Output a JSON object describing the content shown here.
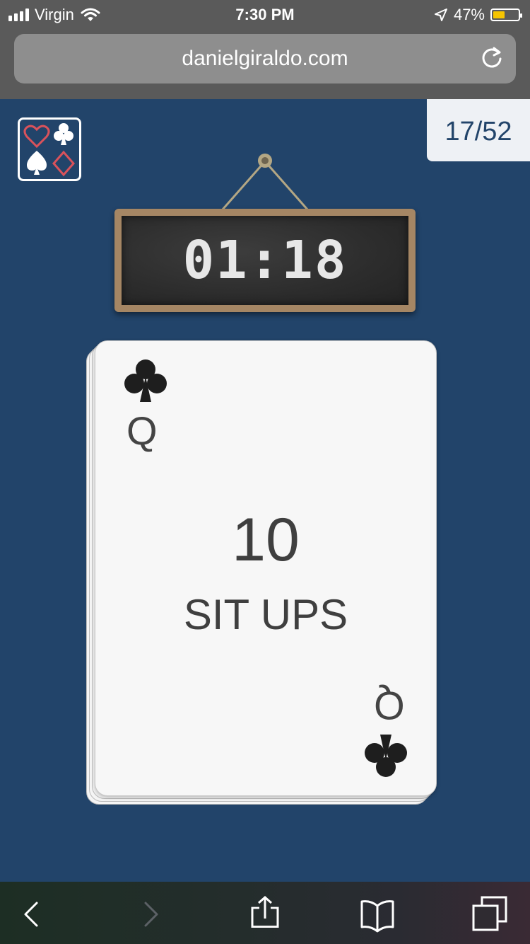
{
  "status_bar": {
    "carrier": "Virgin",
    "time": "7:30 PM",
    "battery_percent": "47%",
    "battery_level": 0.47
  },
  "browser": {
    "url": "danielgiraldo.com"
  },
  "game": {
    "card_counter": "17/52",
    "timer": "01:18",
    "card": {
      "rank": "Q",
      "suit": "clubs",
      "reps": "10",
      "exercise": "SIT UPS"
    }
  },
  "colors": {
    "background": "#22446a",
    "board_frame": "#a58664",
    "battery_fill": "#f5c400"
  },
  "icons": [
    "signal-icon",
    "wifi-icon",
    "location-icon",
    "battery-icon",
    "reload-icon",
    "back-icon",
    "forward-icon",
    "share-icon",
    "bookmarks-icon",
    "tabs-icon",
    "clubs-icon",
    "card-suits-logo"
  ]
}
